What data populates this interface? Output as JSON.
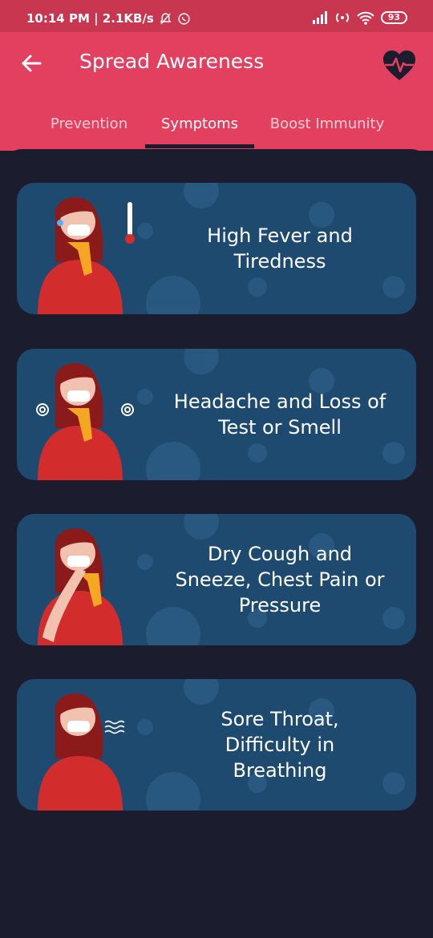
{
  "status": {
    "time_speed": "10:14 PM | 2.1KB/s",
    "battery": "93"
  },
  "header": {
    "title": "Spread Awareness"
  },
  "tabs": [
    {
      "label": "Prevention",
      "active": false
    },
    {
      "label": "Symptoms",
      "active": true
    },
    {
      "label": "Boost Immunity",
      "active": false
    }
  ],
  "cards": [
    {
      "line1": "High Fever and",
      "line2": "Tiredness",
      "line3": ""
    },
    {
      "line1": "Headache and Loss of",
      "line2": "Test or Smell",
      "line3": ""
    },
    {
      "line1": "Dry Cough and",
      "line2": "Sneeze, Chest Pain or",
      "line3": "Pressure"
    },
    {
      "line1": "Sore Throat,",
      "line2": "Difficulty in",
      "line3": "Breathing"
    }
  ],
  "colors": {
    "status_bar": "#c8374f",
    "app_bar": "#e3405f",
    "background": "#1b1c2e",
    "card": "#1f4a70"
  }
}
